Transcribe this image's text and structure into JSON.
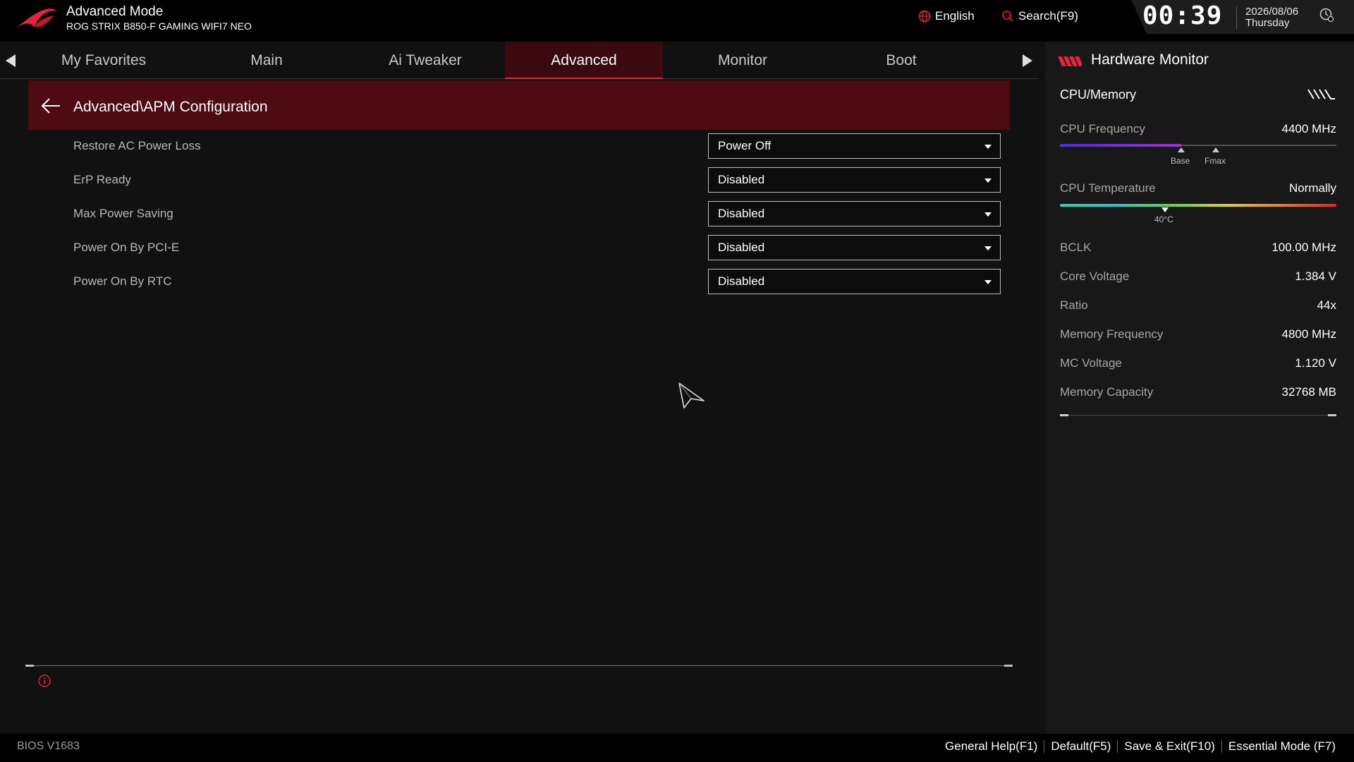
{
  "header": {
    "mode_title": "Advanced Mode",
    "board_name": "ROG STRIX B850-F GAMING WIFI7 NEO",
    "language": "English",
    "search_label": "Search(F9)",
    "time": "00:39",
    "date": "2026/08/06",
    "weekday": "Thursday"
  },
  "tabs": [
    {
      "label": "My Favorites"
    },
    {
      "label": "Main"
    },
    {
      "label": "Ai Tweaker"
    },
    {
      "label": "Advanced"
    },
    {
      "label": "Monitor"
    },
    {
      "label": "Boot"
    }
  ],
  "active_tab": "Advanced",
  "breadcrumb": "Advanced\\APM Configuration",
  "settings": [
    {
      "label": "Restore AC Power Loss",
      "value": "Power Off"
    },
    {
      "label": "ErP Ready",
      "value": "Disabled"
    },
    {
      "label": "Max Power Saving",
      "value": "Disabled"
    },
    {
      "label": "Power On By PCI-E",
      "value": "Disabled"
    },
    {
      "label": "Power On By RTC",
      "value": "Disabled"
    }
  ],
  "hardware_monitor": {
    "title": "Hardware Monitor",
    "section": "CPU/Memory",
    "cpu_frequency": {
      "label": "CPU Frequency",
      "value": "4400 MHz",
      "fill_fraction": 0.44,
      "base_label": "Base",
      "fmax_label": "Fmax"
    },
    "cpu_temperature": {
      "label": "CPU Temperature",
      "value": "Normally",
      "marker_label": "40°C",
      "marker_fraction": 0.38
    },
    "rows": [
      {
        "label": "BCLK",
        "value": "100.00 MHz"
      },
      {
        "label": "Core Voltage",
        "value": "1.384 V"
      },
      {
        "label": "Ratio",
        "value": "44x"
      },
      {
        "label": "Memory Frequency",
        "value": "4800 MHz"
      },
      {
        "label": "MC Voltage",
        "value": "1.120 V"
      },
      {
        "label": "Memory Capacity",
        "value": "32768 MB"
      }
    ]
  },
  "footer": {
    "bios_version": "BIOS V1683",
    "links": [
      "General Help(F1)",
      "Default(F5)",
      "Save & Exit(F10)",
      "Essential Mode (F7)"
    ]
  },
  "colors": {
    "accent_red": "#e5233a",
    "breadcrumb_bg": "#4e0c12",
    "active_tab_bg": "#3a0a0e"
  }
}
